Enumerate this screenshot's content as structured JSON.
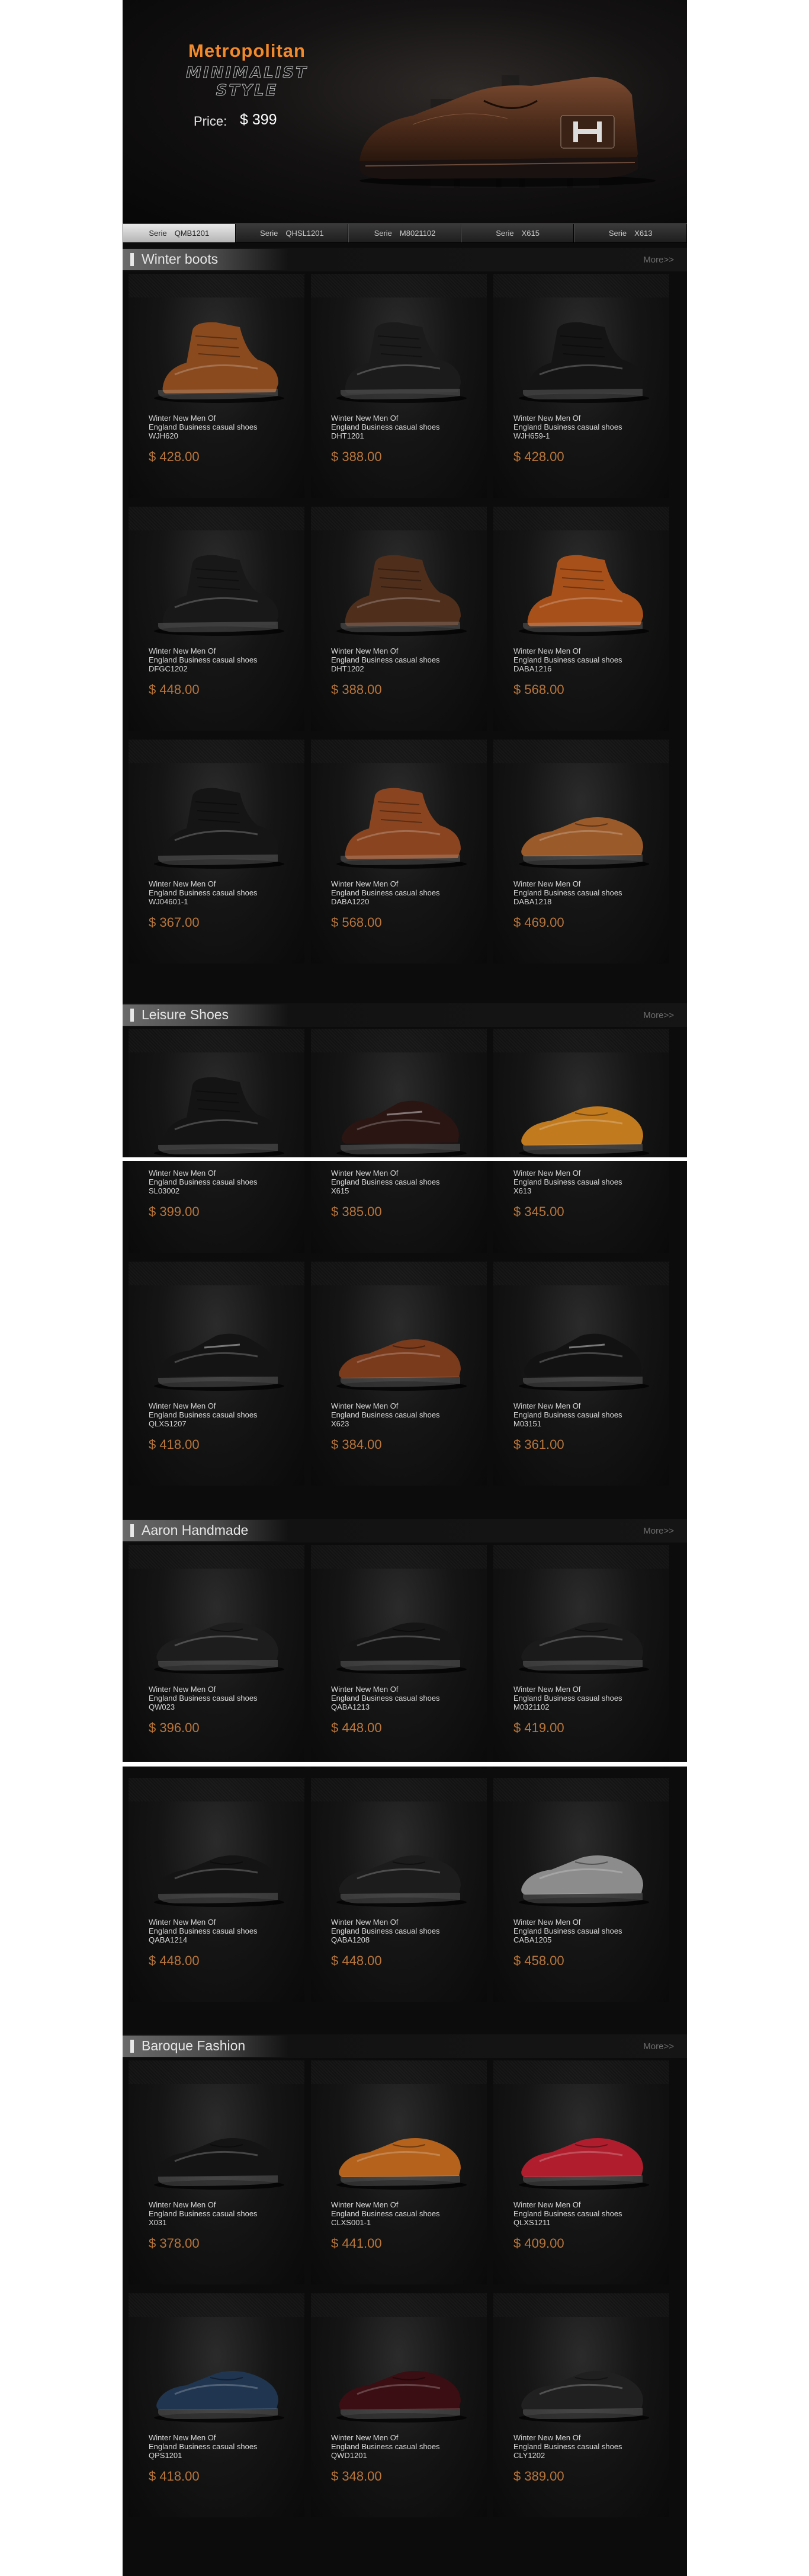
{
  "hero": {
    "title": "Metropolitan",
    "subtitle": "MINIMALIST STYLE",
    "price_label": "Price:",
    "price_value": "$ 399"
  },
  "series_nav": [
    {
      "label": "Serie　QMB1201",
      "active": true
    },
    {
      "label": "Serie　QHSL1201",
      "active": false
    },
    {
      "label": "Serie　M8021102",
      "active": false
    },
    {
      "label": "Serie　X615",
      "active": false
    },
    {
      "label": "Serie　X613",
      "active": false
    }
  ],
  "sections": [
    {
      "title": "Winter boots",
      "more": "More>>",
      "products": [
        {
          "line1": "Winter New Men Of",
          "line2": "England Business casual shoes",
          "code": "WJH620",
          "price": "$ 428.00",
          "color": "#8a4a1e",
          "style": "boot"
        },
        {
          "line1": "Winter New Men Of",
          "line2": "England Business casual shoes",
          "code": "DHT1201",
          "price": "$ 388.00",
          "color": "#1b1b1b",
          "style": "boot"
        },
        {
          "line1": "Winter New Men Of",
          "line2": "England Business casual shoes",
          "code": "WJH659-1",
          "price": "$ 428.00",
          "color": "#141414",
          "style": "boot"
        },
        {
          "line1": "Winter New Men Of",
          "line2": "England Business casual shoes",
          "code": "DFGC1202",
          "price": "$ 448.00",
          "color": "#181818",
          "style": "boot"
        },
        {
          "line1": "Winter New Men Of",
          "line2": "England Business casual shoes",
          "code": "DHT1202",
          "price": "$ 388.00",
          "color": "#4f2e1c",
          "style": "boot"
        },
        {
          "line1": "Winter New Men Of",
          "line2": "England Business casual shoes",
          "code": "DABA1216",
          "price": "$ 568.00",
          "color": "#a8501a",
          "style": "boot"
        },
        {
          "line1": "Winter New Men Of",
          "line2": "England Business casual shoes",
          "code": "WJ04601-1",
          "price": "$ 367.00",
          "color": "#151515",
          "style": "boot"
        },
        {
          "line1": "Winter New Men Of",
          "line2": "England Business casual shoes",
          "code": "DABA1220",
          "price": "$ 568.00",
          "color": "#8a4520",
          "style": "boot"
        },
        {
          "line1": "Winter New Men Of",
          "line2": "England Business casual shoes",
          "code": "DABA1218",
          "price": "$ 469.00",
          "color": "#9a5a2a",
          "style": "shoe"
        }
      ]
    },
    {
      "title": "Leisure Shoes",
      "more": "More>>",
      "products": [
        {
          "line1": "Winter New Men Of",
          "line2": "England Business casual shoes",
          "code": "SL03002",
          "price": "$ 399.00",
          "color": "#141414",
          "style": "boot"
        },
        {
          "line1": "Winter New Men Of",
          "line2": "England Business casual shoes",
          "code": "X615",
          "price": "$ 385.00",
          "color": "#2a1512",
          "style": "sneaker"
        },
        {
          "line1": "Winter New Men Of",
          "line2": "England Business casual shoes",
          "code": "X613",
          "price": "$ 345.00",
          "color": "#c27a1e",
          "style": "shoe"
        },
        {
          "line1": "Winter New Men Of",
          "line2": "England Business casual shoes",
          "code": "QLXS1207",
          "price": "$ 418.00",
          "color": "#141414",
          "style": "sneaker"
        },
        {
          "line1": "Winter New Men Of",
          "line2": "England Business casual shoes",
          "code": "X623",
          "price": "$ 384.00",
          "color": "#7a3a1c",
          "style": "shoe"
        },
        {
          "line1": "Winter New Men Of",
          "line2": "England Business casual shoes",
          "code": "M03151",
          "price": "$ 361.00",
          "color": "#121212",
          "style": "sneaker"
        }
      ]
    },
    {
      "title": "Aaron Handmade",
      "more": "More>>",
      "products": [
        {
          "line1": "Winter New Men Of",
          "line2": "England Business casual shoes",
          "code": "QW023",
          "price": "$ 396.00",
          "color": "#1d1d1d",
          "style": "shoe"
        },
        {
          "line1": "Winter New Men Of",
          "line2": "England Business casual shoes",
          "code": "QABA1213",
          "price": "$ 448.00",
          "color": "#151515",
          "style": "shoe"
        },
        {
          "line1": "Winter New Men Of",
          "line2": "England Business casual shoes",
          "code": "M0321102",
          "price": "$ 419.00",
          "color": "#1a1a1a",
          "style": "shoe"
        },
        {
          "line1": "Winter New Men Of",
          "line2": "England Business casual shoes",
          "code": "QABA1214",
          "price": "$ 448.00",
          "color": "#141414",
          "style": "shoe"
        },
        {
          "line1": "Winter New Men Of",
          "line2": "England Business casual shoes",
          "code": "QABA1208",
          "price": "$ 448.00",
          "color": "#1c1c1c",
          "style": "shoe"
        },
        {
          "line1": "Winter New Men Of",
          "line2": "England Business casual shoes",
          "code": "CABA1205",
          "price": "$ 458.00",
          "color": "#8c8c8c",
          "style": "shoe"
        }
      ]
    },
    {
      "title": "Baroque Fashion",
      "more": "More>>",
      "products": [
        {
          "line1": "Winter New Men Of",
          "line2": "England Business casual shoes",
          "code": "X031",
          "price": "$ 378.00",
          "color": "#141414",
          "style": "shoe"
        },
        {
          "line1": "Winter New Men Of",
          "line2": "England Business casual shoes",
          "code": "CLXS001-1",
          "price": "$ 441.00",
          "color": "#b4621c",
          "style": "shoe"
        },
        {
          "line1": "Winter New Men Of",
          "line2": "England Business casual shoes",
          "code": "QLXS1211",
          "price": "$ 409.00",
          "color": "#b01e2e",
          "style": "shoe"
        },
        {
          "line1": "Winter New Men Of",
          "line2": "England Business casual shoes",
          "code": "QPS1201",
          "price": "$ 418.00",
          "color": "#1f3550",
          "style": "shoe"
        },
        {
          "line1": "Winter New Men Of",
          "line2": "England Business casual shoes",
          "code": "QWD1201",
          "price": "$ 348.00",
          "color": "#3a0e12",
          "style": "shoe"
        },
        {
          "line1": "Winter New Men Of",
          "line2": "England Business casual shoes",
          "code": "CLY1202",
          "price": "$ 389.00",
          "color": "#202020",
          "style": "shoe"
        }
      ]
    }
  ],
  "colors": {
    "accent_orange": "#f28a2b",
    "price": "#b9763c",
    "background": "#0c0c0c"
  }
}
